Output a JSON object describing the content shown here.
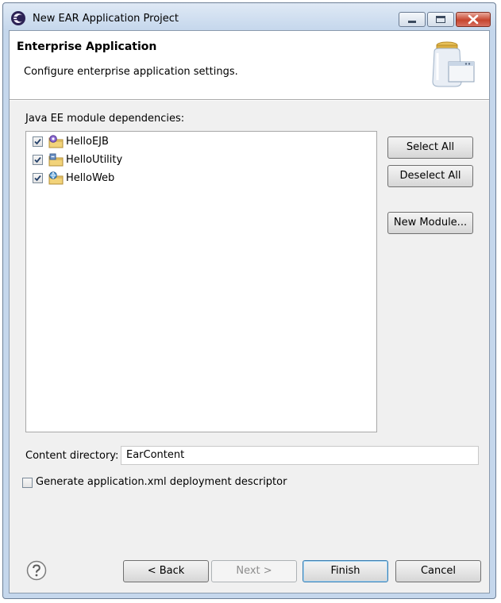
{
  "window": {
    "title": "New EAR Application Project",
    "icon": "eclipse-icon",
    "controls": [
      "minimize-icon",
      "maximize-icon",
      "close-icon"
    ]
  },
  "header": {
    "title": "Enterprise Application",
    "description": "Configure enterprise application settings.",
    "banner_icon": "jar-icon"
  },
  "modules": {
    "label": "Java EE module dependencies:",
    "items": [
      {
        "label": "HelloEJB",
        "checked": true,
        "icon": "ejb-project-icon"
      },
      {
        "label": "HelloUtility",
        "checked": true,
        "icon": "utility-project-icon"
      },
      {
        "label": "HelloWeb",
        "checked": true,
        "icon": "web-project-icon"
      }
    ],
    "select_all": "Select All",
    "deselect_all": "Deselect All",
    "new_module": "New Module..."
  },
  "content_directory": {
    "label": "Content directory:",
    "value": "EarContent"
  },
  "generate_descriptor": {
    "label": "Generate application.xml deployment descriptor",
    "checked": false
  },
  "footer": {
    "help_icon": "help-icon",
    "back": "< Back",
    "next": "Next >",
    "finish": "Finish",
    "cancel": "Cancel"
  },
  "colors": {
    "titlebar": "#c5d7ec",
    "dialog_bg": "#f0f0f0",
    "close_button": "#c6452e"
  }
}
